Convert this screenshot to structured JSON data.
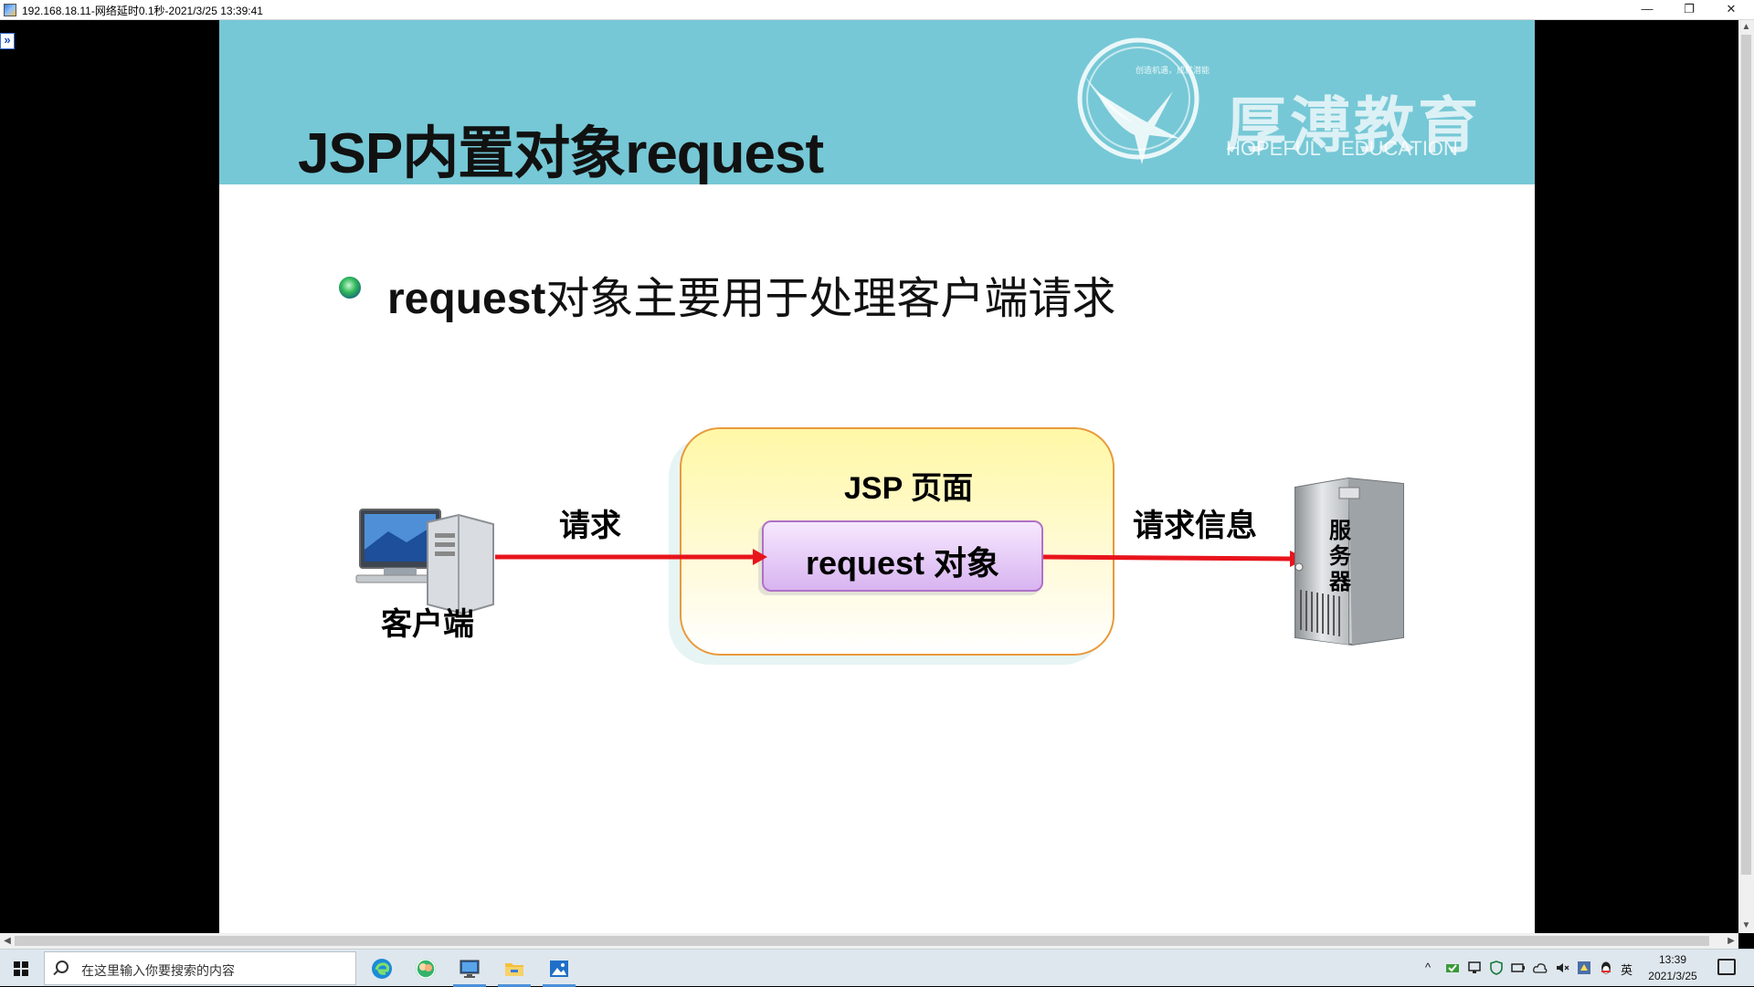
{
  "window": {
    "title": "192.168.18.11-网络延时0.1秒-2021/3/25 13:39:41",
    "min_glyph": "—",
    "restore_glyph": "❐",
    "close_glyph": "✕",
    "expander_glyph": "»"
  },
  "slide": {
    "title": "JSP内置对象request",
    "logo": {
      "name": "厚溥教育",
      "en_left": "HOPEFUL",
      "en_right": "EDUCATION",
      "slogan": "创造机遇，成就潜能"
    },
    "bullet": {
      "bold": "request",
      "rest": "对象主要用于处理客户端请求"
    },
    "diagram": {
      "jsp_page_label": "JSP 页面",
      "request_object_label": "request 对象",
      "arrow_request_label": "请求",
      "arrow_info_label": "请求信息",
      "client_label": "客户端",
      "server_label": "服务器",
      "arrow_color": "#e8141c"
    }
  },
  "scrollbars": {
    "up": "▲",
    "down": "▼",
    "left": "◀",
    "right": "▶"
  },
  "taskbar": {
    "search_placeholder": "在这里输入你要搜索的内容",
    "apps": [
      "edge-icon",
      "people-icon",
      "remote-desktop-icon",
      "file-explorer-icon",
      "photos-icon"
    ],
    "tray": {
      "chevron": "^",
      "ime": "英"
    },
    "clock": {
      "time": "13:39",
      "date": "2021/3/25"
    }
  }
}
